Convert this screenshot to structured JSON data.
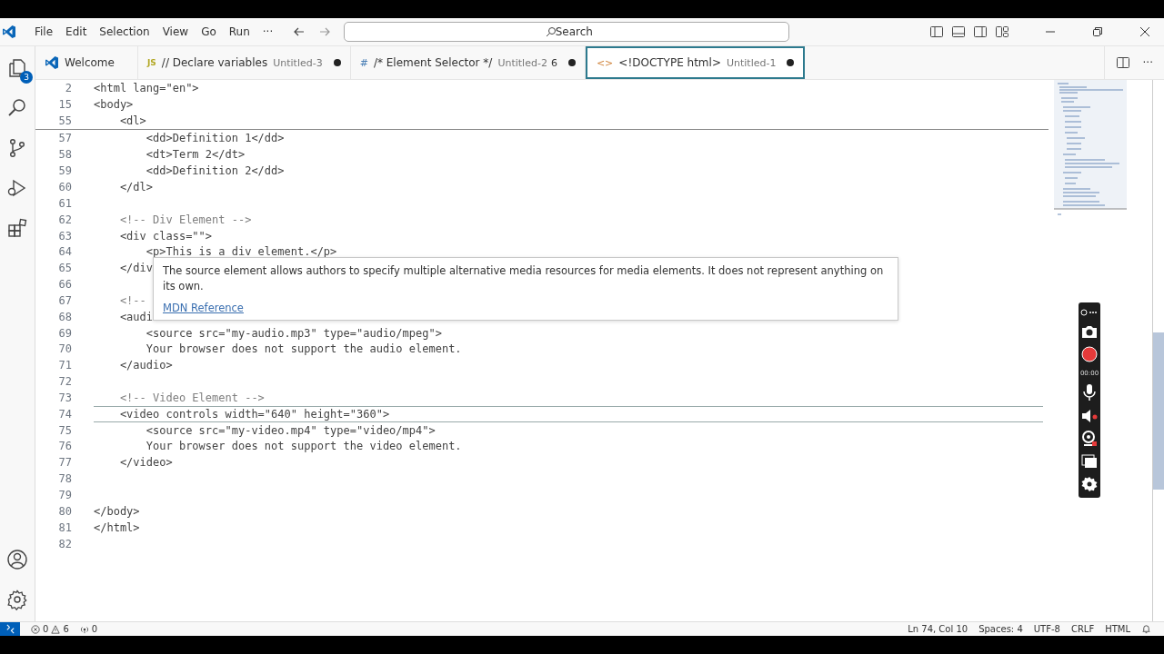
{
  "menu": [
    "File",
    "Edit",
    "Selection",
    "View",
    "Go",
    "Run",
    "···"
  ],
  "search": {
    "placeholder": "Search"
  },
  "activity_bar": {
    "explorer_badge": "3"
  },
  "tabs": [
    {
      "kind": "logo",
      "label": "Welcome",
      "selected": false
    },
    {
      "kind": "js",
      "icon_text": "JS",
      "label": "// Declare variables",
      "file": "Untitled-3",
      "dirty": true,
      "selected": false
    },
    {
      "kind": "css",
      "icon_text": "#",
      "label": "/* Element Selector */",
      "file": "Untitled-2",
      "problems": "6",
      "dirty": true,
      "selected": false
    },
    {
      "kind": "html",
      "icon_text": "<>",
      "label": "<!DOCTYPE html>",
      "file": "Untitled-1",
      "dirty": true,
      "selected": true
    }
  ],
  "sticky_lines": [
    {
      "n": "2",
      "text": "<html lang=\"en\">"
    },
    {
      "n": "15",
      "text": "<body>"
    },
    {
      "n": "55",
      "text": "    <dl>"
    }
  ],
  "lines": [
    {
      "n": "57",
      "text": "        <dd>Definition 1</dd>",
      "kind": "code",
      "current": false
    },
    {
      "n": "58",
      "text": "        <dt>Term 2</dt>",
      "kind": "code",
      "current": false
    },
    {
      "n": "59",
      "text": "        <dd>Definition 2</dd>",
      "kind": "code",
      "current": false
    },
    {
      "n": "60",
      "text": "    </dl>",
      "kind": "code",
      "current": false
    },
    {
      "n": "61",
      "current": false
    },
    {
      "n": "62",
      "text": "    <!-- Div Element -->",
      "kind": "comment",
      "current": false
    },
    {
      "n": "63",
      "text": "    <div class=\"\">",
      "kind": "code",
      "current": false
    },
    {
      "n": "64",
      "text": "        <p>This is a div element.</p>",
      "kind": "code",
      "current": false
    },
    {
      "n": "65",
      "text": "    </div",
      "kind": "code",
      "current": false
    },
    {
      "n": "66",
      "current": false
    },
    {
      "n": "67",
      "text": "    <!--",
      "kind": "comment",
      "current": false
    },
    {
      "n": "68",
      "text": "    <audi",
      "kind": "code",
      "current": false
    },
    {
      "n": "69",
      "text": "        <source src=\"my-audio.mp3\" type=\"audio/mpeg\">",
      "kind": "code",
      "current": false
    },
    {
      "n": "70",
      "text": "        Your browser does not support the audio element.",
      "kind": "code",
      "current": false
    },
    {
      "n": "71",
      "text": "    </audio>",
      "kind": "code",
      "current": false
    },
    {
      "n": "72",
      "current": false
    },
    {
      "n": "73",
      "text": "    <!-- Video Element -->",
      "kind": "comment",
      "current": false
    },
    {
      "n": "74",
      "text": "    <video controls width=\"640\" height=\"360\">",
      "kind": "code",
      "current": true
    },
    {
      "n": "75",
      "text": "        <source src=\"my-video.mp4\" type=\"video/mp4\">",
      "kind": "code",
      "current": false
    },
    {
      "n": "76",
      "text": "        Your browser does not support the video element.",
      "kind": "code",
      "current": false
    },
    {
      "n": "77",
      "text": "    </video>",
      "kind": "code",
      "current": false
    },
    {
      "n": "78",
      "current": false
    },
    {
      "n": "79",
      "current": false
    },
    {
      "n": "80",
      "text": "</body>",
      "kind": "code",
      "current": false
    },
    {
      "n": "81",
      "text": "</html>",
      "kind": "code",
      "current": false
    },
    {
      "n": "82",
      "current": false
    }
  ],
  "editor_actions": {
    "more": "···"
  },
  "hover": {
    "text": "The source element allows authors to specify multiple alternative media resources for media elements. It does not represent anything on its own.",
    "link": "MDN Reference"
  },
  "recorder": {
    "timer": "00:00"
  },
  "status_bar": {
    "errors": "0",
    "warnings": "6",
    "ports": "0",
    "position": "Ln 74, Col 10",
    "spaces": "Spaces: 4",
    "encoding": "UTF-8",
    "eol": "CRLF",
    "language": "HTML"
  }
}
